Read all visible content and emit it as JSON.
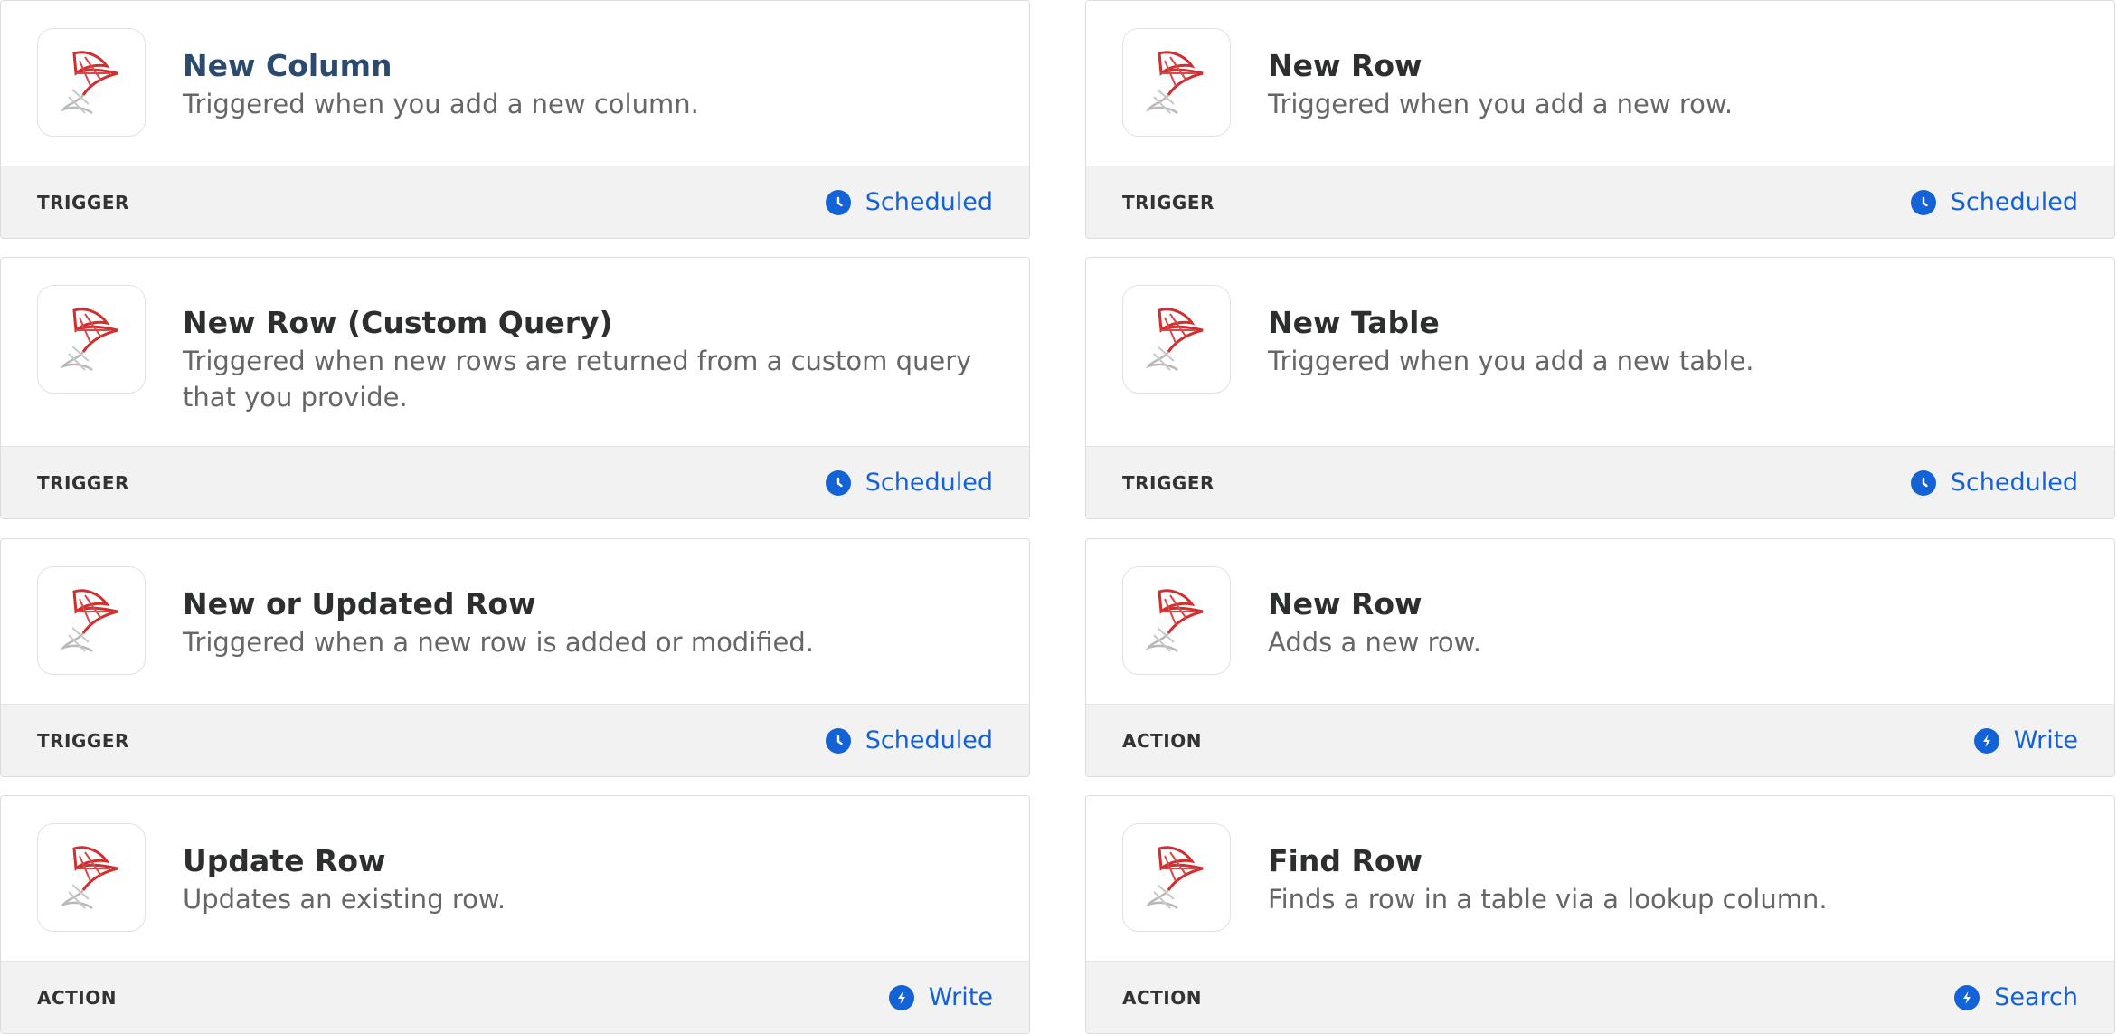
{
  "cards": [
    {
      "title": "New Column",
      "description": "Triggered when you add a new column.",
      "kind": "TRIGGER",
      "badge": "Scheduled",
      "badge_icon": "clock-icon"
    },
    {
      "title": "New Row",
      "description": "Triggered when you add a new row.",
      "kind": "TRIGGER",
      "badge": "Scheduled",
      "badge_icon": "clock-icon"
    },
    {
      "title": "New Row (Custom Query)",
      "description": "Triggered when new rows are returned from a custom query that you provide.",
      "kind": "TRIGGER",
      "badge": "Scheduled",
      "badge_icon": "clock-icon"
    },
    {
      "title": "New Table",
      "description": "Triggered when you add a new table.",
      "kind": "TRIGGER",
      "badge": "Scheduled",
      "badge_icon": "clock-icon"
    },
    {
      "title": "New or Updated Row",
      "description": "Triggered when a new row is added or modified.",
      "kind": "TRIGGER",
      "badge": "Scheduled",
      "badge_icon": "clock-icon"
    },
    {
      "title": "New Row",
      "description": "Adds a new row.",
      "kind": "ACTION",
      "badge": "Write",
      "badge_icon": "lightning-icon"
    },
    {
      "title": "Update Row",
      "description": "Updates an existing row.",
      "kind": "ACTION",
      "badge": "Write",
      "badge_icon": "lightning-icon"
    },
    {
      "title": "Find Row",
      "description": "Finds a row in a table via a lookup column.",
      "kind": "ACTION",
      "badge": "Search",
      "badge_icon": "lightning-icon"
    }
  ],
  "colors": {
    "accent": "#1463d6",
    "title_hover": "#2b4a6e",
    "footer_bg": "#f2f2f2"
  }
}
